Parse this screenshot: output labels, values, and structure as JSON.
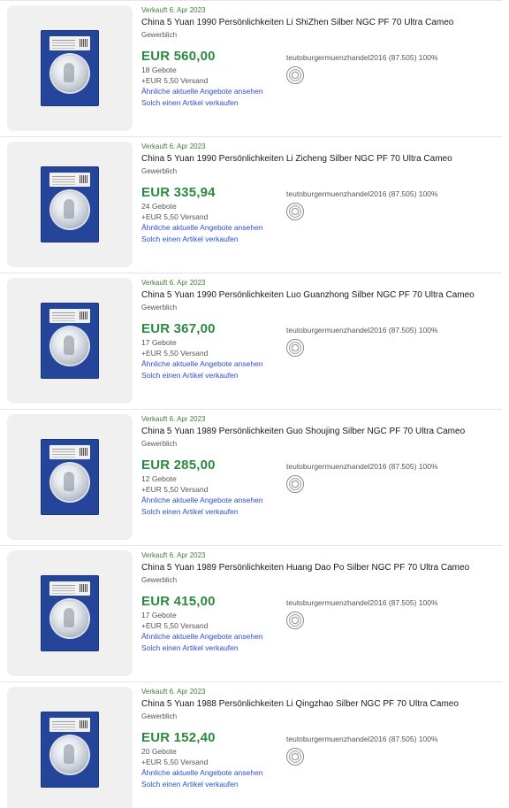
{
  "listings": [
    {
      "date": "Verkauft 6. Apr 2023",
      "title": "China 5 Yuan 1990 Persönlichkeiten Li ShiZhen Silber NGC PF 70 Ultra Cameo",
      "condition": "Gewerblich",
      "price": "EUR 560,00",
      "bids": "18 Gebote",
      "shipping": "+EUR 5,50 Versand",
      "link_similar": "Ähnliche aktuelle Angebote ansehen",
      "link_sell": "Solch einen Artikel verkaufen",
      "seller": "teutoburgermuenzhandel2016 (87.505) 100%"
    },
    {
      "date": "Verkauft 6. Apr 2023",
      "title": "China 5 Yuan 1990 Persönlichkeiten Li Zicheng Silber NGC PF 70 Ultra Cameo",
      "condition": "Gewerblich",
      "price": "EUR 335,94",
      "bids": "24 Gebote",
      "shipping": "+EUR 5,50 Versand",
      "link_similar": "Ähnliche aktuelle Angebote ansehen",
      "link_sell": "Solch einen Artikel verkaufen",
      "seller": "teutoburgermuenzhandel2016 (87.505) 100%"
    },
    {
      "date": "Verkauft 6. Apr 2023",
      "title": "China 5 Yuan 1990 Persönlichkeiten Luo Guanzhong Silber NGC PF 70 Ultra Cameo",
      "condition": "Gewerblich",
      "price": "EUR 367,00",
      "bids": "17 Gebote",
      "shipping": "+EUR 5,50 Versand",
      "link_similar": "Ähnliche aktuelle Angebote ansehen",
      "link_sell": "Solch einen Artikel verkaufen",
      "seller": "teutoburgermuenzhandel2016 (87.505) 100%"
    },
    {
      "date": "Verkauft 6. Apr 2023",
      "title": "China 5 Yuan 1989 Persönlichkeiten Guo Shoujing Silber NGC PF 70 Ultra Cameo",
      "condition": "Gewerblich",
      "price": "EUR 285,00",
      "bids": "12 Gebote",
      "shipping": "+EUR 5,50 Versand",
      "link_similar": "Ähnliche aktuelle Angebote ansehen",
      "link_sell": "Solch einen Artikel verkaufen",
      "seller": "teutoburgermuenzhandel2016 (87.505) 100%"
    },
    {
      "date": "Verkauft 6. Apr 2023",
      "title": "China 5 Yuan 1989 Persönlichkeiten Huang Dao Po Silber NGC PF 70 Ultra Cameo",
      "condition": "Gewerblich",
      "price": "EUR 415,00",
      "bids": "17 Gebote",
      "shipping": "+EUR 5,50 Versand",
      "link_similar": "Ähnliche aktuelle Angebote ansehen",
      "link_sell": "Solch einen Artikel verkaufen",
      "seller": "teutoburgermuenzhandel2016 (87.505) 100%"
    },
    {
      "date": "Verkauft 6. Apr 2023",
      "title": "China 5 Yuan 1988 Persönlichkeiten Li Qingzhao Silber NGC PF 70 Ultra Cameo",
      "condition": "Gewerblich",
      "price": "EUR 152,40",
      "bids": "20 Gebote",
      "shipping": "+EUR 5,50 Versand",
      "link_similar": "Ähnliche aktuelle Angebote ansehen",
      "link_sell": "Solch einen Artikel verkaufen",
      "seller": "teutoburgermuenzhandel2016 (87.505) 100%"
    }
  ],
  "colors": {
    "price": "#2b8a3e",
    "sold_date": "#3b7f36",
    "link": "#2a4ed1",
    "slab": "#24459a"
  },
  "icons": {
    "thumbnail": "coin-slab-image",
    "seller_badge": "seller-seal-icon"
  }
}
